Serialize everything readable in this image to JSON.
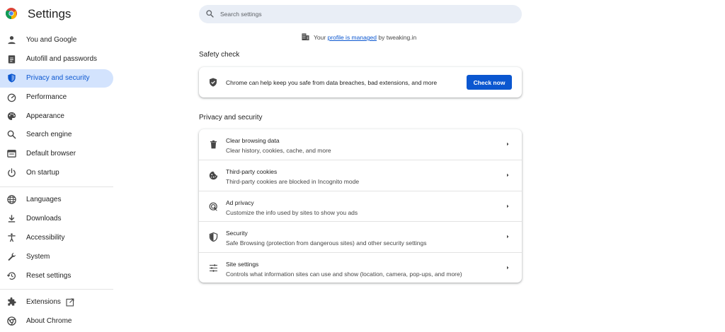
{
  "app": {
    "title": "Settings",
    "colors": {
      "accent": "#0b57d0",
      "active_bg": "#d3e3fd",
      "search_bg": "#e9eef6"
    }
  },
  "sidebar": {
    "items": [
      {
        "label": "You and Google",
        "icon": "person-icon"
      },
      {
        "label": "Autofill and passwords",
        "icon": "clipboard-icon"
      },
      {
        "label": "Privacy and security",
        "icon": "shield-icon",
        "active": true
      },
      {
        "label": "Performance",
        "icon": "speedometer-icon"
      },
      {
        "label": "Appearance",
        "icon": "palette-icon"
      },
      {
        "label": "Search engine",
        "icon": "search-icon"
      },
      {
        "label": "Default browser",
        "icon": "browser-window-icon"
      },
      {
        "label": "On startup",
        "icon": "power-icon"
      },
      {
        "label": "Languages",
        "icon": "globe-icon"
      },
      {
        "label": "Downloads",
        "icon": "download-icon"
      },
      {
        "label": "Accessibility",
        "icon": "accessibility-icon"
      },
      {
        "label": "System",
        "icon": "wrench-icon"
      },
      {
        "label": "Reset settings",
        "icon": "history-icon"
      },
      {
        "label": "Extensions",
        "icon": "puzzle-icon"
      },
      {
        "label": "About Chrome",
        "icon": "chrome-icon"
      }
    ]
  },
  "search": {
    "placeholder": "Search settings",
    "value": ""
  },
  "managed": {
    "prefix": "Your ",
    "link": "profile is managed",
    "suffix": " by tweaking.in"
  },
  "safety_check": {
    "heading": "Safety check",
    "message": "Chrome can help keep you safe from data breaches, bad extensions, and more",
    "button": "Check now"
  },
  "privacy": {
    "heading": "Privacy and security",
    "rows": [
      {
        "title": "Clear browsing data",
        "subtitle": "Clear history, cookies, cache, and more",
        "icon": "trash-icon"
      },
      {
        "title": "Third-party cookies",
        "subtitle": "Third-party cookies are blocked in Incognito mode",
        "icon": "cookie-icon"
      },
      {
        "title": "Ad privacy",
        "subtitle": "Customize the info used by sites to show you ads",
        "icon": "ad-privacy-icon"
      },
      {
        "title": "Security",
        "subtitle": "Safe Browsing (protection from dangerous sites) and other security settings",
        "icon": "shield-icon"
      },
      {
        "title": "Site settings",
        "subtitle": "Controls what information sites can use and show (location, camera, pop-ups, and more)",
        "icon": "sliders-icon"
      }
    ]
  }
}
